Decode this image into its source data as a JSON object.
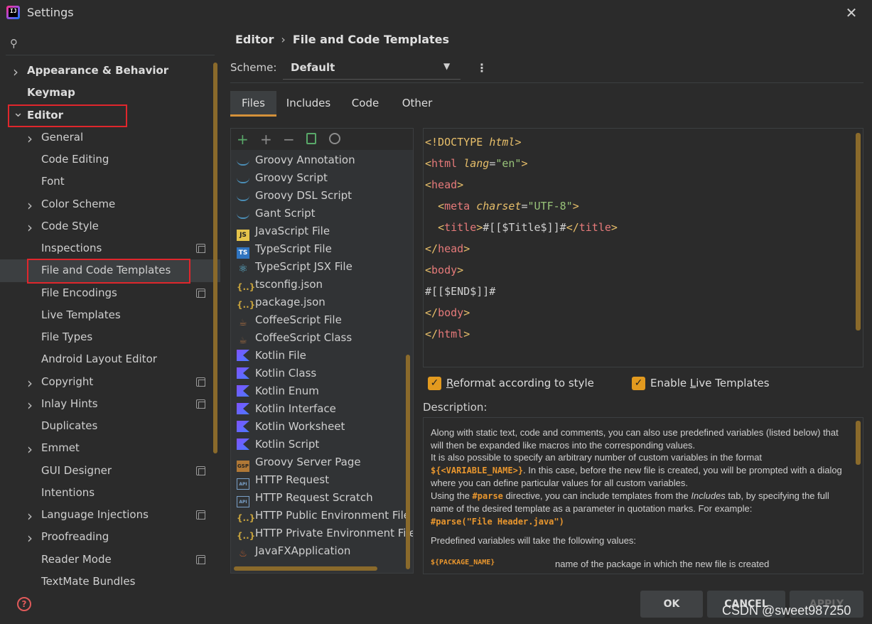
{
  "window": {
    "title": "Settings",
    "close_icon": "close-icon",
    "app_icon_label": "IJ"
  },
  "sidebar": {
    "search_icon": "search-icon",
    "items": [
      {
        "label": "Appearance & Behavior",
        "expandable": true,
        "bold": true
      },
      {
        "label": "Keymap",
        "expandable": false,
        "bold": true
      },
      {
        "label": "Editor",
        "expanded": true,
        "bold": true
      },
      {
        "label": "General",
        "expandable": true
      },
      {
        "label": "Code Editing"
      },
      {
        "label": "Font"
      },
      {
        "label": "Color Scheme",
        "expandable": true
      },
      {
        "label": "Code Style",
        "expandable": true
      },
      {
        "label": "Inspections",
        "project_badge": true
      },
      {
        "label": "File and Code Templates",
        "selected": true
      },
      {
        "label": "File Encodings",
        "project_badge": true
      },
      {
        "label": "Live Templates"
      },
      {
        "label": "File Types"
      },
      {
        "label": "Android Layout Editor"
      },
      {
        "label": "Copyright",
        "expandable": true,
        "project_badge": true
      },
      {
        "label": "Inlay Hints",
        "expandable": true,
        "project_badge": true
      },
      {
        "label": "Duplicates"
      },
      {
        "label": "Emmet",
        "expandable": true
      },
      {
        "label": "GUI Designer",
        "project_badge": true
      },
      {
        "label": "Intentions"
      },
      {
        "label": "Language Injections",
        "expandable": true,
        "project_badge": true
      },
      {
        "label": "Proofreading",
        "expandable": true
      },
      {
        "label": "Reader Mode",
        "project_badge": true
      },
      {
        "label": "TextMate Bundles"
      }
    ],
    "help_icon": "help-icon"
  },
  "breadcrumb": {
    "parent": "Editor",
    "separator": "›",
    "current": "File and Code Templates"
  },
  "scheme": {
    "label": "Scheme:",
    "value": "Default",
    "more_icon": "kebab-menu-icon"
  },
  "tabs": [
    "Files",
    "Includes",
    "Code",
    "Other"
  ],
  "active_tab": "Files",
  "templates_toolbar": {
    "add": "+",
    "add_child": "+",
    "remove": "−",
    "copy_icon": "copy-icon",
    "reset_icon": "reset-icon"
  },
  "templates": [
    {
      "label": "Groovy Annotation",
      "icon": "groovy"
    },
    {
      "label": "Groovy Script",
      "icon": "groovy"
    },
    {
      "label": "Groovy DSL Script",
      "icon": "groovy"
    },
    {
      "label": "Gant Script",
      "icon": "groovy"
    },
    {
      "label": "JavaScript File",
      "icon": "js"
    },
    {
      "label": "TypeScript File",
      "icon": "ts"
    },
    {
      "label": "TypeScript JSX File",
      "icon": "react"
    },
    {
      "label": "tsconfig.json",
      "icon": "json"
    },
    {
      "label": "package.json",
      "icon": "json"
    },
    {
      "label": "CoffeeScript File",
      "icon": "coffee"
    },
    {
      "label": "CoffeeScript Class",
      "icon": "coffee"
    },
    {
      "label": "Kotlin File",
      "icon": "kotlin"
    },
    {
      "label": "Kotlin Class",
      "icon": "kotlin"
    },
    {
      "label": "Kotlin Enum",
      "icon": "kotlin"
    },
    {
      "label": "Kotlin Interface",
      "icon": "kotlin"
    },
    {
      "label": "Kotlin Worksheet",
      "icon": "kotlin"
    },
    {
      "label": "Kotlin Script",
      "icon": "kotlin"
    },
    {
      "label": "Groovy Server Page",
      "icon": "gsp"
    },
    {
      "label": "HTTP Request",
      "icon": "api"
    },
    {
      "label": "HTTP Request Scratch",
      "icon": "api"
    },
    {
      "label": "HTTP Public Environment File",
      "icon": "json"
    },
    {
      "label": "HTTP Private Environment File",
      "icon": "json"
    },
    {
      "label": "JavaFXApplication",
      "icon": "java"
    }
  ],
  "icon_text": {
    "js": "JS",
    "ts": "TS",
    "react": "⚛",
    "json": "{..}",
    "coffee": "☕",
    "gsp": "GSP",
    "api": "API",
    "java": "♨"
  },
  "code_lines": [
    [
      [
        "tag",
        "<!DOCTYPE "
      ],
      [
        "attr",
        "html"
      ],
      [
        "tag",
        ">"
      ]
    ],
    [
      [
        "tag",
        "<"
      ],
      [
        "tagname",
        "html"
      ],
      [
        "plain",
        " "
      ],
      [
        "attr",
        "lang"
      ],
      [
        "plain",
        "="
      ],
      [
        "str",
        "\"en\""
      ],
      [
        "tag",
        ">"
      ]
    ],
    [
      [
        "tag",
        "<"
      ],
      [
        "tagname",
        "head"
      ],
      [
        "tag",
        ">"
      ]
    ],
    [
      [
        "plain",
        "  "
      ],
      [
        "tag",
        "<"
      ],
      [
        "tagname",
        "meta"
      ],
      [
        "plain",
        " "
      ],
      [
        "attr",
        "charset"
      ],
      [
        "plain",
        "="
      ],
      [
        "str",
        "\"UTF-8\""
      ],
      [
        "tag",
        ">"
      ]
    ],
    [
      [
        "plain",
        "  "
      ],
      [
        "tag",
        "<"
      ],
      [
        "tagname",
        "title"
      ],
      [
        "tag",
        ">"
      ],
      [
        "plain",
        "#[[$Title$]]#"
      ],
      [
        "tag",
        "</"
      ],
      [
        "tagname",
        "title"
      ],
      [
        "tag",
        ">"
      ]
    ],
    [
      [
        "tag",
        "</"
      ],
      [
        "tagname",
        "head"
      ],
      [
        "tag",
        ">"
      ]
    ],
    [
      [
        "tag",
        "<"
      ],
      [
        "tagname",
        "body"
      ],
      [
        "tag",
        ">"
      ]
    ],
    [
      [
        "plain",
        "#[[$END$]]#"
      ]
    ],
    [
      [
        "tag",
        "</"
      ],
      [
        "tagname",
        "body"
      ],
      [
        "tag",
        ">"
      ]
    ],
    [
      [
        "tag",
        "</"
      ],
      [
        "tagname",
        "html"
      ],
      [
        "tag",
        ">"
      ]
    ]
  ],
  "options": {
    "reformat": {
      "checked": true,
      "label_before": "",
      "mnemonic": "R",
      "label_after": "eformat according to style"
    },
    "live_templates": {
      "checked": true,
      "label_before": "Enable ",
      "mnemonic": "L",
      "label_after": "ive Templates"
    }
  },
  "description": {
    "label": "Description:",
    "p1_a": "Along with static text, code and comments, you can also use predefined variables (listed below) that will then be expanded like macros into the corresponding values.",
    "p1_b": "It is also possible to specify an arbitrary number of custom variables in the format ",
    "p1_var": "${<VARIABLE_NAME>}",
    "p1_c": ". In this case, before the new file is created, you will be prompted with a dialog where you can define particular values for all custom variables.",
    "p1_d": "Using the ",
    "p1_parse": "#parse",
    "p1_e": " directive, you can include templates from the ",
    "p1_includes": "Includes",
    "p1_f": " tab, by specifying the full name of the desired template as a parameter in quotation marks. For example:",
    "p1_example": "#parse(\"File Header.java\")",
    "p2": "Predefined variables will take the following values:",
    "var_key": "${PACKAGE_NAME}",
    "var_value": "name of the package in which the new file is created"
  },
  "buttons": {
    "ok": "OK",
    "cancel": "CANCEL",
    "apply": "APPLY"
  },
  "watermark": "CSDN @sweet987250"
}
